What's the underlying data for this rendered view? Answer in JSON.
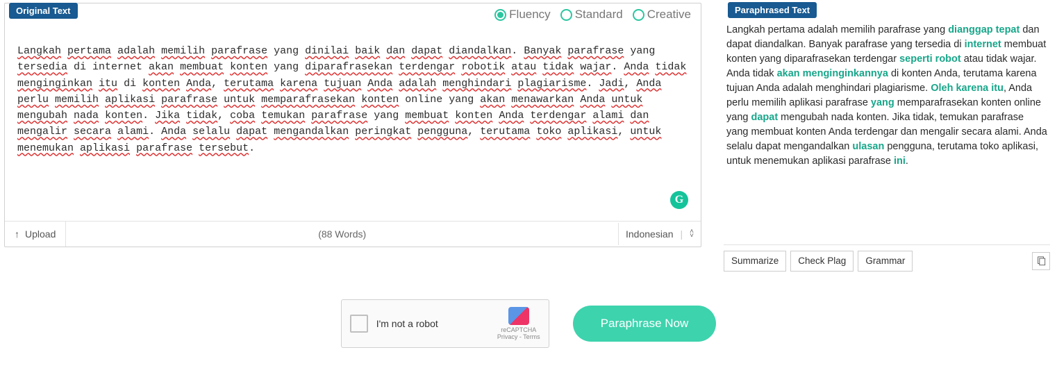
{
  "left": {
    "badge": "Original Text",
    "modes": {
      "fluency": "Fluency",
      "standard": "Standard",
      "creative": "Creative",
      "selected": "fluency"
    },
    "text_parts": [
      {
        "u": true,
        "t": "Langkah"
      },
      {
        "t": " "
      },
      {
        "u": true,
        "t": "pertama"
      },
      {
        "t": " "
      },
      {
        "u": true,
        "t": "adalah"
      },
      {
        "t": " "
      },
      {
        "u": true,
        "t": "memilih"
      },
      {
        "t": " "
      },
      {
        "u": true,
        "t": "parafrase"
      },
      {
        "t": " yang "
      },
      {
        "u": true,
        "t": "dinilai"
      },
      {
        "t": " "
      },
      {
        "u": true,
        "t": "baik"
      },
      {
        "t": " "
      },
      {
        "u": true,
        "t": "dan"
      },
      {
        "t": " "
      },
      {
        "u": true,
        "t": "dapat"
      },
      {
        "t": " "
      },
      {
        "u": true,
        "t": "diandalkan"
      },
      {
        "t": ". "
      },
      {
        "u": true,
        "t": "Banyak"
      },
      {
        "t": " "
      },
      {
        "u": true,
        "t": "parafrase"
      },
      {
        "t": " yang "
      },
      {
        "u": true,
        "t": "tersedia"
      },
      {
        "t": " di internet "
      },
      {
        "u": true,
        "t": "akan"
      },
      {
        "t": " "
      },
      {
        "u": true,
        "t": "membuat"
      },
      {
        "t": " "
      },
      {
        "u": true,
        "t": "konten"
      },
      {
        "t": " yang "
      },
      {
        "u": true,
        "t": "diparafrasekan"
      },
      {
        "t": " "
      },
      {
        "u": true,
        "t": "terdengar"
      },
      {
        "t": " "
      },
      {
        "u": true,
        "t": "robotik"
      },
      {
        "t": " "
      },
      {
        "u": true,
        "t": "atau"
      },
      {
        "t": " "
      },
      {
        "u": true,
        "t": "tidak"
      },
      {
        "t": " "
      },
      {
        "u": true,
        "t": "wajar"
      },
      {
        "t": ". "
      },
      {
        "u": true,
        "t": "Anda"
      },
      {
        "t": " "
      },
      {
        "u": true,
        "t": "tidak"
      },
      {
        "t": " "
      },
      {
        "u": true,
        "t": "menginginkan"
      },
      {
        "t": " "
      },
      {
        "u": true,
        "t": "itu"
      },
      {
        "t": " di "
      },
      {
        "u": true,
        "t": "konten"
      },
      {
        "t": " "
      },
      {
        "u": true,
        "t": "Anda"
      },
      {
        "t": ", "
      },
      {
        "u": true,
        "t": "terutama"
      },
      {
        "t": " "
      },
      {
        "u": true,
        "t": "karena"
      },
      {
        "t": " "
      },
      {
        "u": true,
        "t": "tujuan"
      },
      {
        "t": " "
      },
      {
        "u": true,
        "t": "Anda"
      },
      {
        "t": " "
      },
      {
        "u": true,
        "t": "adalah"
      },
      {
        "t": " "
      },
      {
        "u": true,
        "t": "menghindari"
      },
      {
        "t": " "
      },
      {
        "u": true,
        "t": "plagiarisme"
      },
      {
        "t": ". "
      },
      {
        "u": true,
        "t": "Jadi"
      },
      {
        "t": ", "
      },
      {
        "u": true,
        "t": "Anda"
      },
      {
        "t": " "
      },
      {
        "u": true,
        "t": "perlu"
      },
      {
        "t": " "
      },
      {
        "u": true,
        "t": "memilih"
      },
      {
        "t": " "
      },
      {
        "u": true,
        "t": "aplikasi"
      },
      {
        "t": " "
      },
      {
        "u": true,
        "t": "parafrase"
      },
      {
        "t": " "
      },
      {
        "u": true,
        "t": "untuk"
      },
      {
        "t": " "
      },
      {
        "u": true,
        "t": "memparafrasekan"
      },
      {
        "t": " "
      },
      {
        "u": true,
        "t": "konten"
      },
      {
        "t": " online yang "
      },
      {
        "u": true,
        "t": "akan"
      },
      {
        "t": " "
      },
      {
        "u": true,
        "t": "menawarkan"
      },
      {
        "t": " "
      },
      {
        "u": true,
        "t": "Anda"
      },
      {
        "t": " "
      },
      {
        "u": true,
        "t": "untuk"
      },
      {
        "t": " "
      },
      {
        "u": true,
        "t": "mengubah"
      },
      {
        "t": " "
      },
      {
        "u": true,
        "t": "nada"
      },
      {
        "t": " "
      },
      {
        "u": true,
        "t": "konten"
      },
      {
        "t": ". "
      },
      {
        "u": true,
        "t": "Jika"
      },
      {
        "t": " "
      },
      {
        "u": true,
        "t": "tidak"
      },
      {
        "t": ", "
      },
      {
        "u": true,
        "t": "coba"
      },
      {
        "t": " "
      },
      {
        "u": true,
        "t": "temukan"
      },
      {
        "t": " "
      },
      {
        "u": true,
        "t": "parafrase"
      },
      {
        "t": " yang "
      },
      {
        "u": true,
        "t": "membuat"
      },
      {
        "t": " "
      },
      {
        "u": true,
        "t": "konten"
      },
      {
        "t": " "
      },
      {
        "u": true,
        "t": "Anda"
      },
      {
        "t": " "
      },
      {
        "u": true,
        "t": "terdengar"
      },
      {
        "t": " "
      },
      {
        "u": true,
        "t": "alami"
      },
      {
        "t": " "
      },
      {
        "u": true,
        "t": "dan"
      },
      {
        "t": " "
      },
      {
        "u": true,
        "t": "mengalir"
      },
      {
        "t": " "
      },
      {
        "u": true,
        "t": "secara"
      },
      {
        "t": " "
      },
      {
        "u": true,
        "t": "alami"
      },
      {
        "t": ". "
      },
      {
        "u": true,
        "t": "Anda"
      },
      {
        "t": " "
      },
      {
        "u": true,
        "t": "selalu"
      },
      {
        "t": " "
      },
      {
        "u": true,
        "t": "dapat"
      },
      {
        "t": " "
      },
      {
        "u": true,
        "t": "mengandalkan"
      },
      {
        "t": " "
      },
      {
        "u": true,
        "t": "peringkat"
      },
      {
        "t": " "
      },
      {
        "u": true,
        "t": "pengguna"
      },
      {
        "t": ", "
      },
      {
        "u": true,
        "t": "terutama"
      },
      {
        "t": " "
      },
      {
        "u": true,
        "t": "toko"
      },
      {
        "t": " "
      },
      {
        "u": true,
        "t": "aplikasi"
      },
      {
        "t": ", "
      },
      {
        "u": true,
        "t": "untuk"
      },
      {
        "t": " "
      },
      {
        "u": true,
        "t": "menemukan"
      },
      {
        "t": " "
      },
      {
        "u": true,
        "t": "aplikasi"
      },
      {
        "t": " "
      },
      {
        "u": true,
        "t": "parafrase"
      },
      {
        "t": " "
      },
      {
        "u": true,
        "t": "tersebut"
      },
      {
        "t": "."
      }
    ],
    "upload": "Upload",
    "word_count": "(88 Words)",
    "language": "Indonesian"
  },
  "right": {
    "badge": "Paraphrased Text",
    "para_parts": [
      {
        "t": "Langkah pertama adalah memilih parafrase yang "
      },
      {
        "hl": true,
        "t": "dianggap tepat"
      },
      {
        "t": " dan dapat diandalkan. Banyak parafrase yang tersedia di "
      },
      {
        "hl": true,
        "t": "internet"
      },
      {
        "t": " membuat konten yang diparafrasekan terdengar "
      },
      {
        "hl": true,
        "t": "seperti robot"
      },
      {
        "t": " atau tidak wajar. Anda tidak "
      },
      {
        "hl": true,
        "t": "akan menginginkannya"
      },
      {
        "t": " di konten Anda, terutama karena tujuan Anda adalah menghindari plagiarisme. "
      },
      {
        "hl": true,
        "t": "Oleh karena itu"
      },
      {
        "t": ", Anda perlu memilih aplikasi parafrase "
      },
      {
        "hl": true,
        "t": "yang"
      },
      {
        "t": " memparafrasekan konten online yang "
      },
      {
        "hl": true,
        "t": "dapat"
      },
      {
        "t": " mengubah nada konten. Jika tidak, temukan parafrase yang membuat konten Anda terdengar  dan mengalir secara alami. Anda selalu dapat mengandalkan "
      },
      {
        "hl": true,
        "t": "ulasan"
      },
      {
        "t": " pengguna, terutama toko aplikasi, untuk menemukan aplikasi parafrase "
      },
      {
        "hl": true,
        "t": "ini"
      },
      {
        "t": "."
      }
    ],
    "summarize": "Summarize",
    "check_plag": "Check Plag",
    "grammar": "Grammar"
  },
  "captcha": {
    "label": "I'm not a robot",
    "brand": "reCAPTCHA",
    "legal": "Privacy - Terms"
  },
  "action": {
    "paraphrase": "Paraphrase Now"
  },
  "grammarly_glyph": "G"
}
